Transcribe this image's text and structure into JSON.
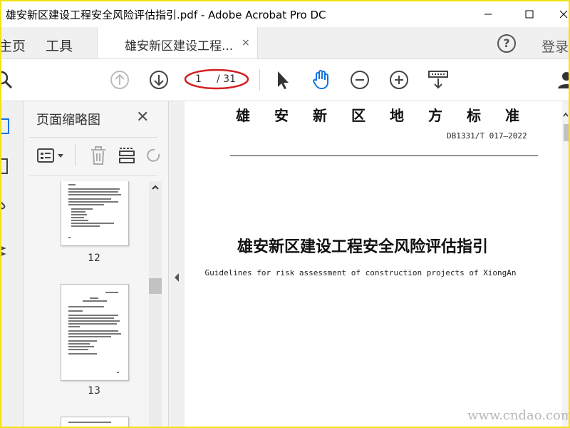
{
  "window": {
    "title": "雄安新区建设工程安全风险评估指引.pdf - Adobe Acrobat Pro DC",
    "minimize_icon": "minimize-icon",
    "maximize_icon": "maximize-icon",
    "close_icon": "close-icon"
  },
  "tabs": {
    "home": "主页",
    "tools": "工具",
    "document": "雄安新区建设工程...",
    "close": "×"
  },
  "header_right": {
    "help": "?",
    "login": "登录"
  },
  "toolbar": {
    "current_page": "1",
    "total_pages": "/ 31",
    "icons": [
      "search-icon",
      "previous-page-icon",
      "next-page-icon",
      "select-arrow-icon",
      "hand-tool-icon",
      "zoom-out-icon",
      "zoom-in-icon",
      "scroll-mode-icon",
      "user-icon"
    ]
  },
  "thumbnails_panel": {
    "title": "页面缩略图",
    "close": "✕",
    "pages": [
      "12",
      "13"
    ]
  },
  "document": {
    "header": "雄安新区地方标准",
    "code": "DB1331/T 017—2022",
    "title": "雄安新区建设工程安全风险评估指引",
    "subtitle": "Guidelines for risk assessment of construction projects of XiongAn"
  },
  "watermark": "www.cndao.com",
  "colors": {
    "frame_border": "#f2e313",
    "hand_tool_active": "#1473e6",
    "annotation_circle": "#d42020"
  }
}
